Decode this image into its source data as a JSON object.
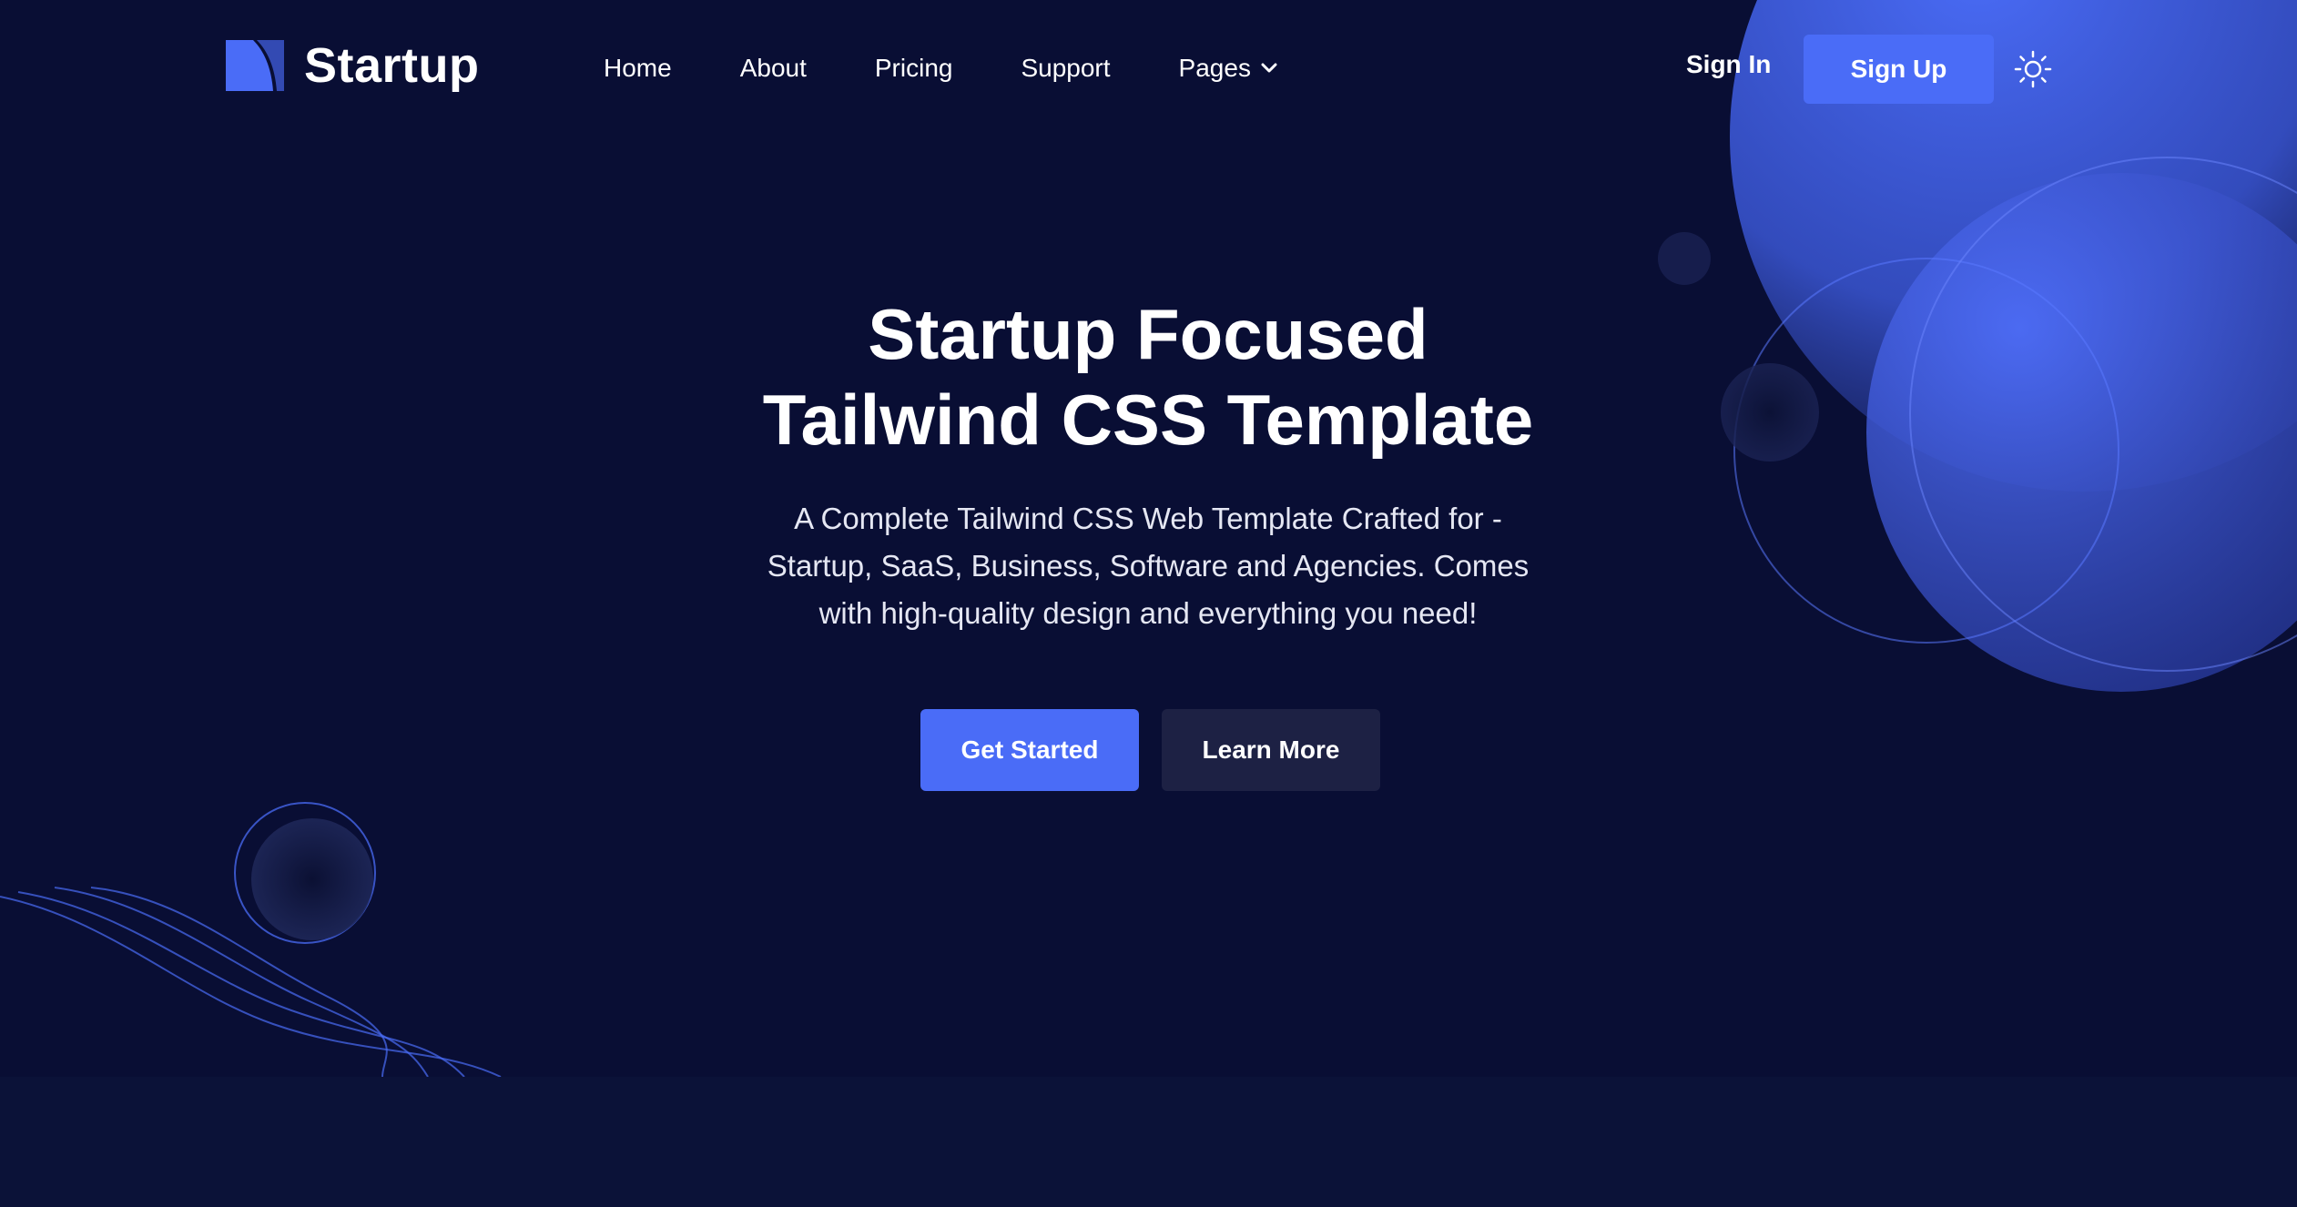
{
  "brand": {
    "name": "Startup",
    "logo_icon": "startup-logo-icon"
  },
  "nav": {
    "items": [
      {
        "label": "Home"
      },
      {
        "label": "About"
      },
      {
        "label": "Pricing"
      },
      {
        "label": "Support"
      },
      {
        "label": "Pages",
        "icon": "chevron-down-icon"
      }
    ]
  },
  "auth": {
    "signin_label": "Sign In",
    "signup_label": "Sign Up"
  },
  "theme_toggle": {
    "icon": "sun-icon"
  },
  "hero": {
    "title_lines": [
      "Startup Focused",
      "Tailwind CSS Template"
    ],
    "description_lines": [
      "A Complete Tailwind CSS Web Template Crafted for -",
      "Startup, SaaS, Business, Software and Agencies. Comes",
      "with high-quality design and everything you need!"
    ],
    "primary_cta": "Get Started",
    "secondary_cta": "Learn More"
  },
  "colors": {
    "background": "#090e34",
    "accent": "#4a6cf7",
    "secondary_button": "#1d2144",
    "footer_band": "#0b1238"
  }
}
